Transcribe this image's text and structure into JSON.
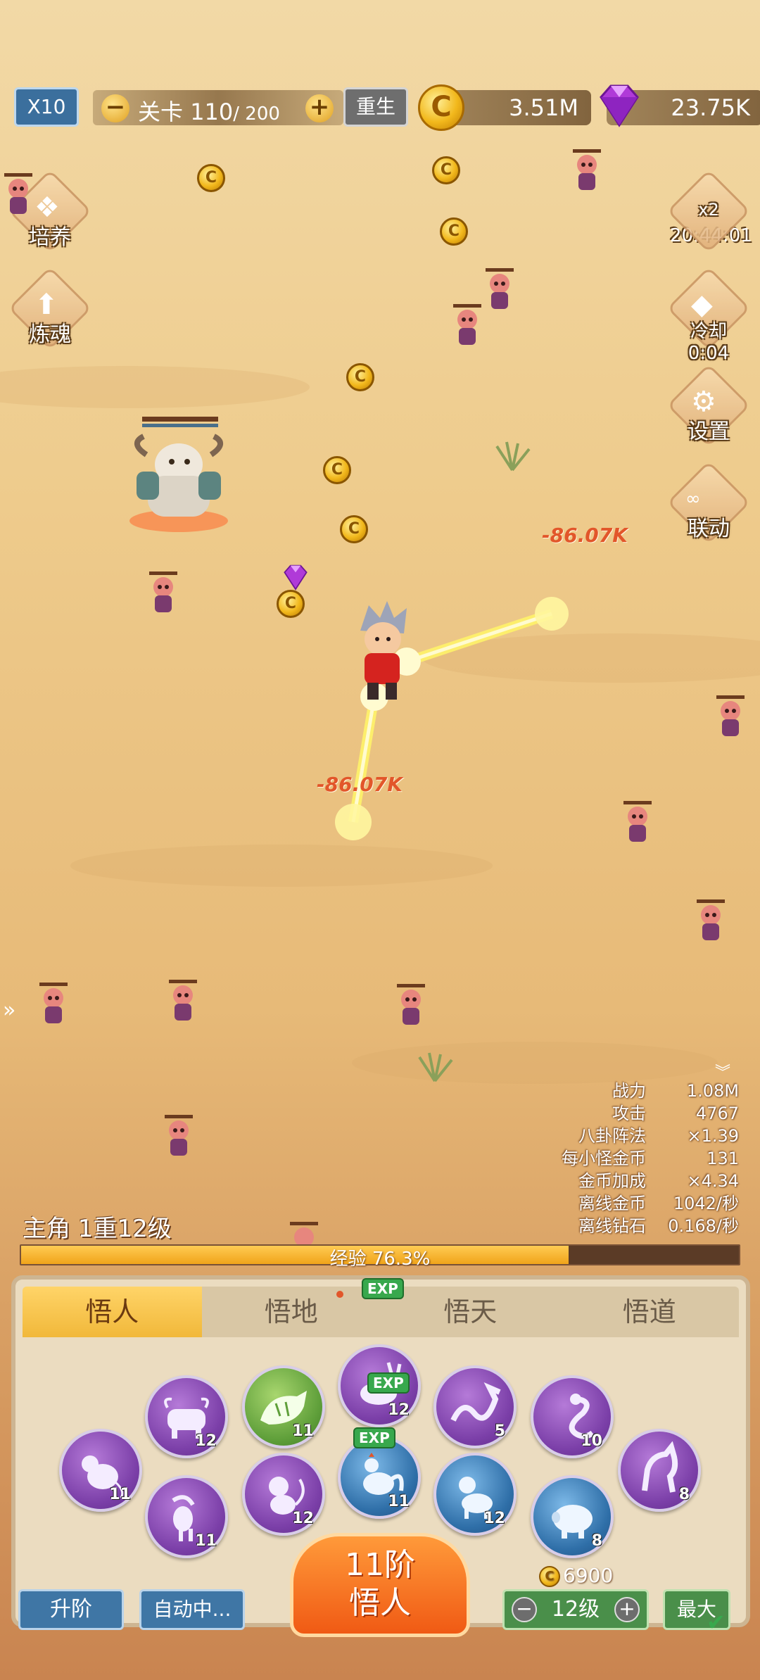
{
  "topbar": {
    "speed_label": "X10",
    "stage_label": "关卡",
    "stage_current": "110",
    "stage_total": "/ 200",
    "rebirth_label": "重生",
    "gold": "3.51M",
    "gems": "23.75K"
  },
  "left_menu": {
    "cultivate": "培养",
    "refine_soul": "炼魂"
  },
  "right_menu": {
    "boost_label": "x2",
    "boost_timer": "20:44:01",
    "cooldown": "冷却 0:04",
    "settings": "设置",
    "link": "联动"
  },
  "damage_popups": [
    "-86.07K",
    "-86.07K"
  ],
  "stats": [
    {
      "k": "战力",
      "v": "1.08M"
    },
    {
      "k": "攻击",
      "v": "4767"
    },
    {
      "k": "八卦阵法",
      "v": "×1.39"
    },
    {
      "k": "每小怪金币",
      "v": "131"
    },
    {
      "k": "金币加成",
      "v": "×4.34"
    },
    {
      "k": "离线金币",
      "v": "1042/秒"
    },
    {
      "k": "离线钻石",
      "v": "0.168/秒"
    }
  ],
  "hero": {
    "level_text": "主角 1重12级",
    "exp_text": "经验 76.3%",
    "exp_progress": 0.763
  },
  "tabs": [
    "悟人",
    "悟地",
    "悟天",
    "悟道"
  ],
  "exp_tag": "EXP",
  "zodiac": [
    {
      "name": "rat",
      "level": "11"
    },
    {
      "name": "ox",
      "level": "12"
    },
    {
      "name": "tiger",
      "level": "11"
    },
    {
      "name": "rabbit",
      "level": "12"
    },
    {
      "name": "dragon",
      "level": "5"
    },
    {
      "name": "snake",
      "level": "10"
    },
    {
      "name": "horse",
      "level": "8"
    },
    {
      "name": "goat",
      "level": "11"
    },
    {
      "name": "monkey",
      "level": "12"
    },
    {
      "name": "rooster",
      "level": "11"
    },
    {
      "name": "dog",
      "level": "12"
    },
    {
      "name": "pig",
      "level": "8"
    }
  ],
  "bottom": {
    "upgrade_label": "升阶",
    "auto_label": "自动中...",
    "main_button_line1": "11阶",
    "main_button_line2": "悟人",
    "cost": "6900",
    "level_value": "12级",
    "max_label": "最大"
  },
  "colors": {
    "accent_orange": "#f05a14",
    "button_blue": "#3f76a5",
    "button_green": "#4a8f4a",
    "exp_fill": "#f0a41a"
  }
}
